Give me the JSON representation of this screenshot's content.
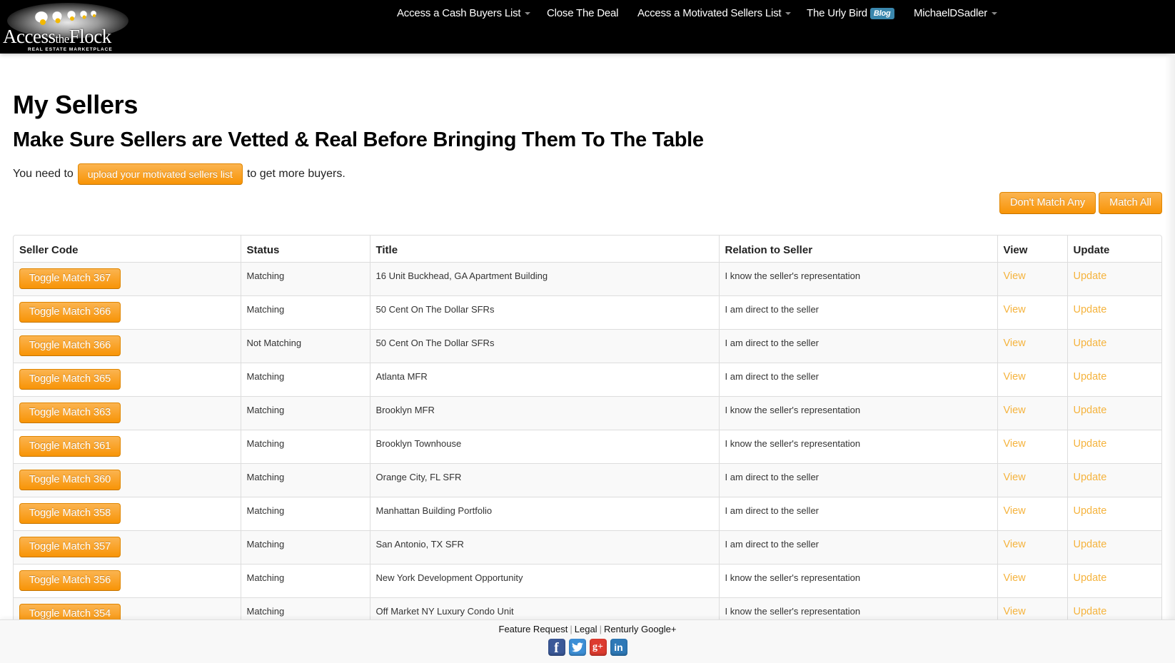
{
  "brand": {
    "logo_title_a": "Access",
    "logo_title_the": "the",
    "logo_title_b": "Flock",
    "logo_subtitle": "REAL ESTATE MARKETPLACE"
  },
  "nav": {
    "items": [
      {
        "label": "Access a Cash Buyers List",
        "has_dropdown": true
      },
      {
        "label": "Close The Deal",
        "has_dropdown": false
      },
      {
        "label": "Access a Motivated Sellers List",
        "has_dropdown": true
      },
      {
        "label": "The Urly Bird",
        "badge": "Blog",
        "has_dropdown": false
      },
      {
        "label": "MichaelDSadler",
        "has_dropdown": true
      }
    ]
  },
  "page": {
    "title": "My Sellers",
    "subtitle": "Make Sure Sellers are Vetted & Real Before Bringing Them To The Table",
    "notice_prefix": "You need to",
    "upload_button": "upload your motivated sellers list",
    "notice_suffix": "to get more buyers."
  },
  "bulk_actions": {
    "dont_match_any": "Don't Match Any",
    "match_all": "Match All"
  },
  "table": {
    "headers": [
      "Seller Code",
      "Status",
      "Title",
      "Relation to Seller",
      "View",
      "Update"
    ],
    "rows": [
      {
        "toggle": "Toggle Match 367",
        "status": "Matching",
        "title": "16 Unit Buckhead, GA Apartment Building",
        "relation": "I know the seller's representation",
        "view": "View",
        "update": "Update"
      },
      {
        "toggle": "Toggle Match 366",
        "status": "Matching",
        "title": "50 Cent On The Dollar SFRs",
        "relation": "I am direct to the seller",
        "view": "View",
        "update": "Update"
      },
      {
        "toggle": "Toggle Match 366",
        "status": "Not Matching",
        "title": "50 Cent On The Dollar SFRs",
        "relation": "I am direct to the seller",
        "view": "View",
        "update": "Update"
      },
      {
        "toggle": "Toggle Match 365",
        "status": "Matching",
        "title": "Atlanta MFR",
        "relation": "I am direct to the seller",
        "view": "View",
        "update": "Update"
      },
      {
        "toggle": "Toggle Match 363",
        "status": "Matching",
        "title": "Brooklyn MFR",
        "relation": "I know the seller's representation",
        "view": "View",
        "update": "Update"
      },
      {
        "toggle": "Toggle Match 361",
        "status": "Matching",
        "title": "Brooklyn Townhouse",
        "relation": "I know the seller's representation",
        "view": "View",
        "update": "Update"
      },
      {
        "toggle": "Toggle Match 360",
        "status": "Matching",
        "title": "Orange City, FL SFR",
        "relation": "I am direct to the seller",
        "view": "View",
        "update": "Update"
      },
      {
        "toggle": "Toggle Match 358",
        "status": "Matching",
        "title": "Manhattan Building Portfolio",
        "relation": "I am direct to the seller",
        "view": "View",
        "update": "Update"
      },
      {
        "toggle": "Toggle Match 357",
        "status": "Matching",
        "title": "San Antonio, TX SFR",
        "relation": "I am direct to the seller",
        "view": "View",
        "update": "Update"
      },
      {
        "toggle": "Toggle Match 356",
        "status": "Matching",
        "title": "New York Development Opportunity",
        "relation": "I know the seller's representation",
        "view": "View",
        "update": "Update"
      },
      {
        "toggle": "Toggle Match 354",
        "status": "Matching",
        "title": "Off Market NY Luxury Condo Unit",
        "relation": "I know the seller's representation",
        "view": "View",
        "update": "Update"
      }
    ]
  },
  "footer": {
    "links": [
      "Feature Request",
      "Legal",
      "Renturly Google+"
    ],
    "social": [
      {
        "name": "facebook",
        "glyph": "f"
      },
      {
        "name": "twitter",
        "glyph": "t"
      },
      {
        "name": "google-plus",
        "glyph": "g+"
      },
      {
        "name": "linkedin",
        "glyph": "in"
      }
    ]
  },
  "colors": {
    "navbar_bg": "#000000",
    "accent_orange_top": "#fbb450",
    "accent_orange_bottom": "#f89406",
    "link_orange": "#f5b33d",
    "blog_badge": "#3a87ad"
  }
}
